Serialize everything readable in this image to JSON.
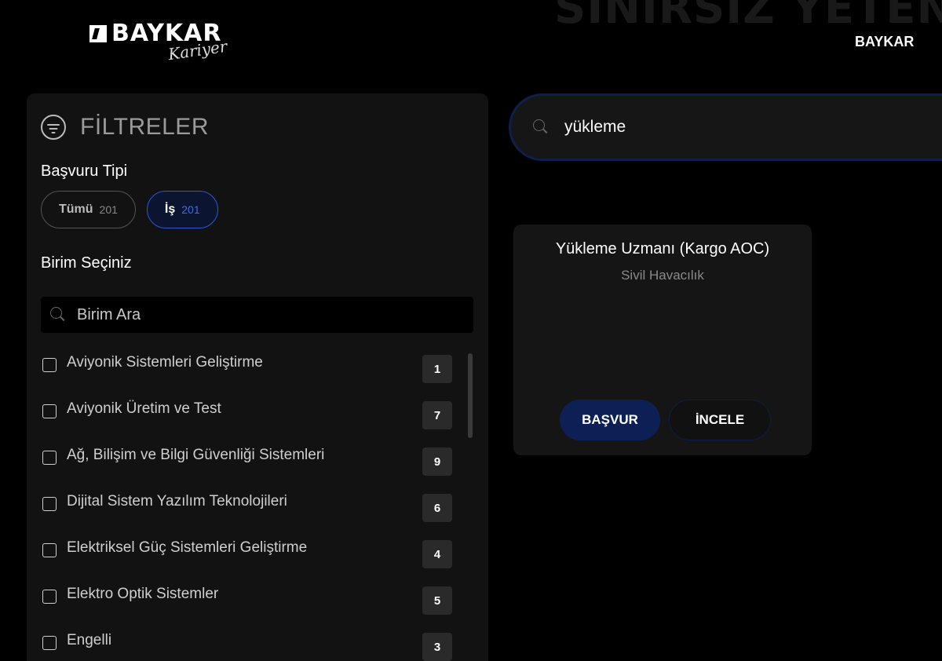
{
  "header": {
    "logo_text": "BAYKAR",
    "logo_script": "Kariyer",
    "background_tagline": "SINIRSIZ YETENEK",
    "brand_link": "BAYKAR"
  },
  "filters": {
    "title": "FİLTRELER",
    "application_type_label": "Başvuru Tipi",
    "type_pills": [
      {
        "label": "Tümü",
        "count": "201",
        "selected": false
      },
      {
        "label": "İş",
        "count": "201",
        "selected": true
      }
    ],
    "unit_label": "Birim Seçiniz",
    "unit_search_placeholder": "Birim Ara",
    "units": [
      {
        "label": "Aviyonik Sistemleri Geliştirme",
        "count": "1"
      },
      {
        "label": "Aviyonik Üretim ve Test",
        "count": "7"
      },
      {
        "label": "Ağ, Bilişim ve Bilgi Güvenliği Sistemleri",
        "count": "9"
      },
      {
        "label": "Dijital Sistem Yazılım Teknolojileri",
        "count": "6"
      },
      {
        "label": "Elektriksel Güç Sistemleri Geliştirme",
        "count": "4"
      },
      {
        "label": "Elektro Optik Sistemler",
        "count": "5"
      },
      {
        "label": "Engelli",
        "count": "3"
      }
    ]
  },
  "search": {
    "value": "yükleme"
  },
  "job": {
    "title": "Yükleme Uzmanı (Kargo AOC)",
    "department": "Sivil Havacılık",
    "apply_label": "BAŞVUR",
    "view_label": "İNCELE"
  },
  "colors": {
    "background": "#000000",
    "panel": "#121212",
    "accent_blue": "#2a58d6",
    "button_blue": "#0d2055"
  }
}
